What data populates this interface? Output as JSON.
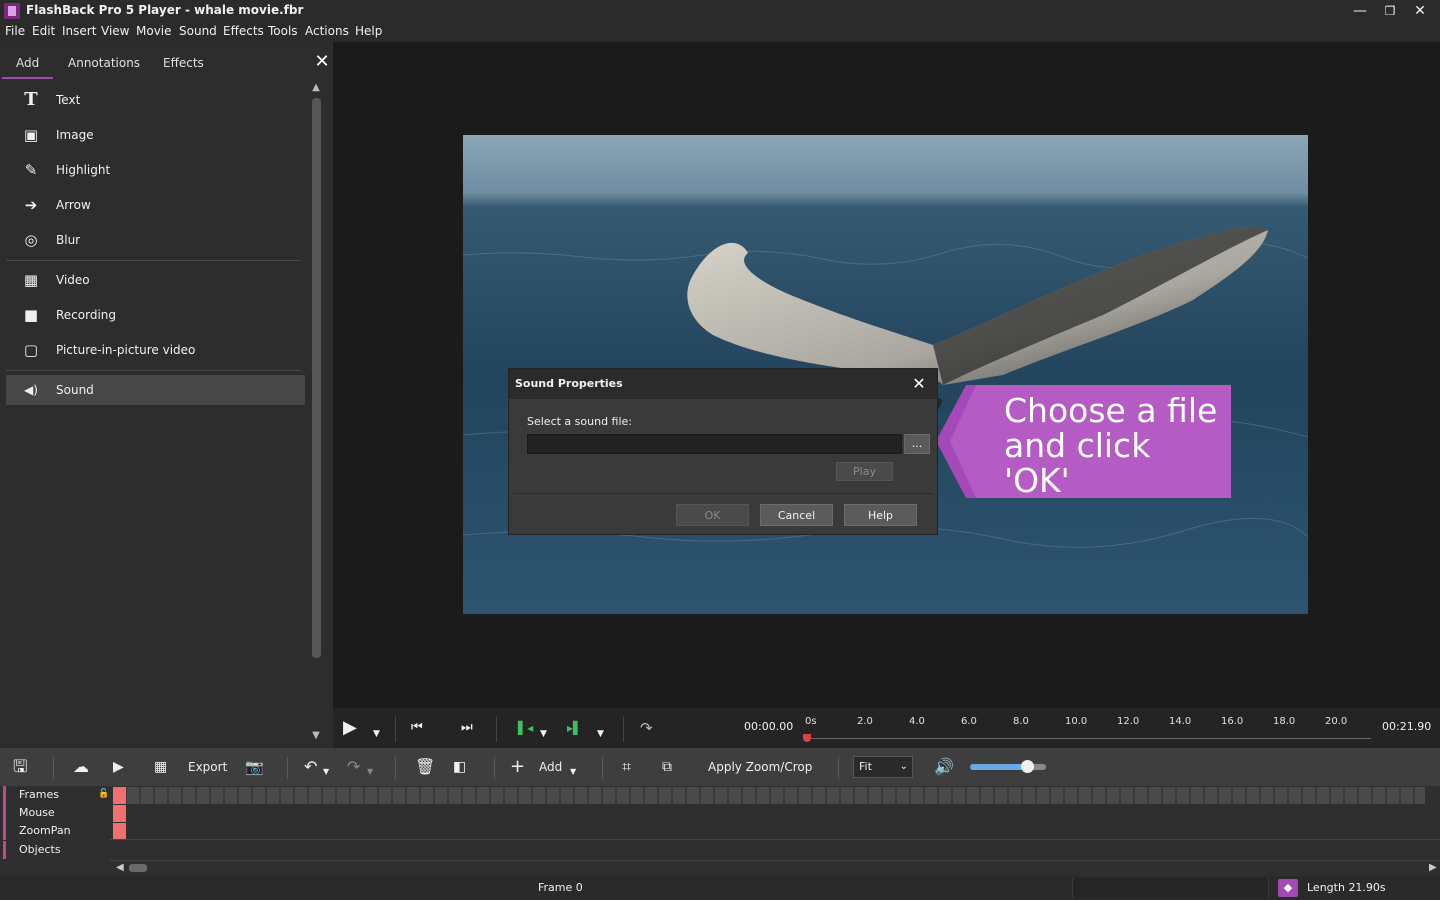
{
  "window": {
    "title": "FlashBack Pro 5 Player - whale movie.fbr",
    "minimize": "—",
    "restore": "❐",
    "close": "✕"
  },
  "menu": [
    "File",
    "Edit",
    "Insert",
    "View",
    "Movie",
    "Sound",
    "Effects",
    "Tools",
    "Actions",
    "Help"
  ],
  "panel": {
    "tabs": [
      "Add",
      "Annotations",
      "Effects"
    ],
    "active_tab": "Add",
    "close": "✕",
    "items": [
      {
        "icon": "text-icon",
        "glyph": "T",
        "label": "Text"
      },
      {
        "icon": "image-icon",
        "glyph": "▣",
        "label": "Image"
      },
      {
        "icon": "highlight-brush-icon",
        "glyph": "✎",
        "label": "Highlight"
      },
      {
        "icon": "arrow-icon",
        "glyph": "➔",
        "label": "Arrow"
      },
      {
        "icon": "blur-eye-icon",
        "glyph": "◎",
        "label": "Blur"
      },
      {
        "icon": "video-film-icon",
        "glyph": "▦",
        "label": "Video"
      },
      {
        "icon": "recording-camera-icon",
        "glyph": "■",
        "label": "Recording"
      },
      {
        "icon": "picture-in-picture-icon",
        "glyph": "▢",
        "label": "Picture-in-picture video"
      },
      {
        "icon": "sound-speaker-icon",
        "glyph": "◀)",
        "label": "Sound"
      }
    ],
    "selected_item": "Sound"
  },
  "dialog": {
    "title": "Sound Properties",
    "close": "✕",
    "file_label": "Select a sound file:",
    "file_value": "",
    "browse": "...",
    "play": "Play",
    "ok": "OK",
    "cancel": "Cancel",
    "help": "Help"
  },
  "callout": {
    "line1": "Choose a file",
    "line2": "and click 'OK'",
    "color": "#b45bc4"
  },
  "transport": {
    "current_time": "00:00.00",
    "total_time": "00:21.90",
    "ruler_ticks": [
      "0s",
      "2.0",
      "4.0",
      "6.0",
      "8.0",
      "10.0",
      "12.0",
      "14.0",
      "16.0",
      "18.0",
      "20.0"
    ]
  },
  "toolbar": {
    "export": "Export",
    "add": "Add",
    "apply_zoom": "Apply Zoom/Crop",
    "fit": "Fit",
    "volume_fraction": 0.75
  },
  "timeline": {
    "rows": [
      "Frames",
      "Mouse",
      "ZoomPan",
      "Objects"
    ]
  },
  "status": {
    "frame": "Frame 0",
    "length": "Length 21.90s"
  }
}
